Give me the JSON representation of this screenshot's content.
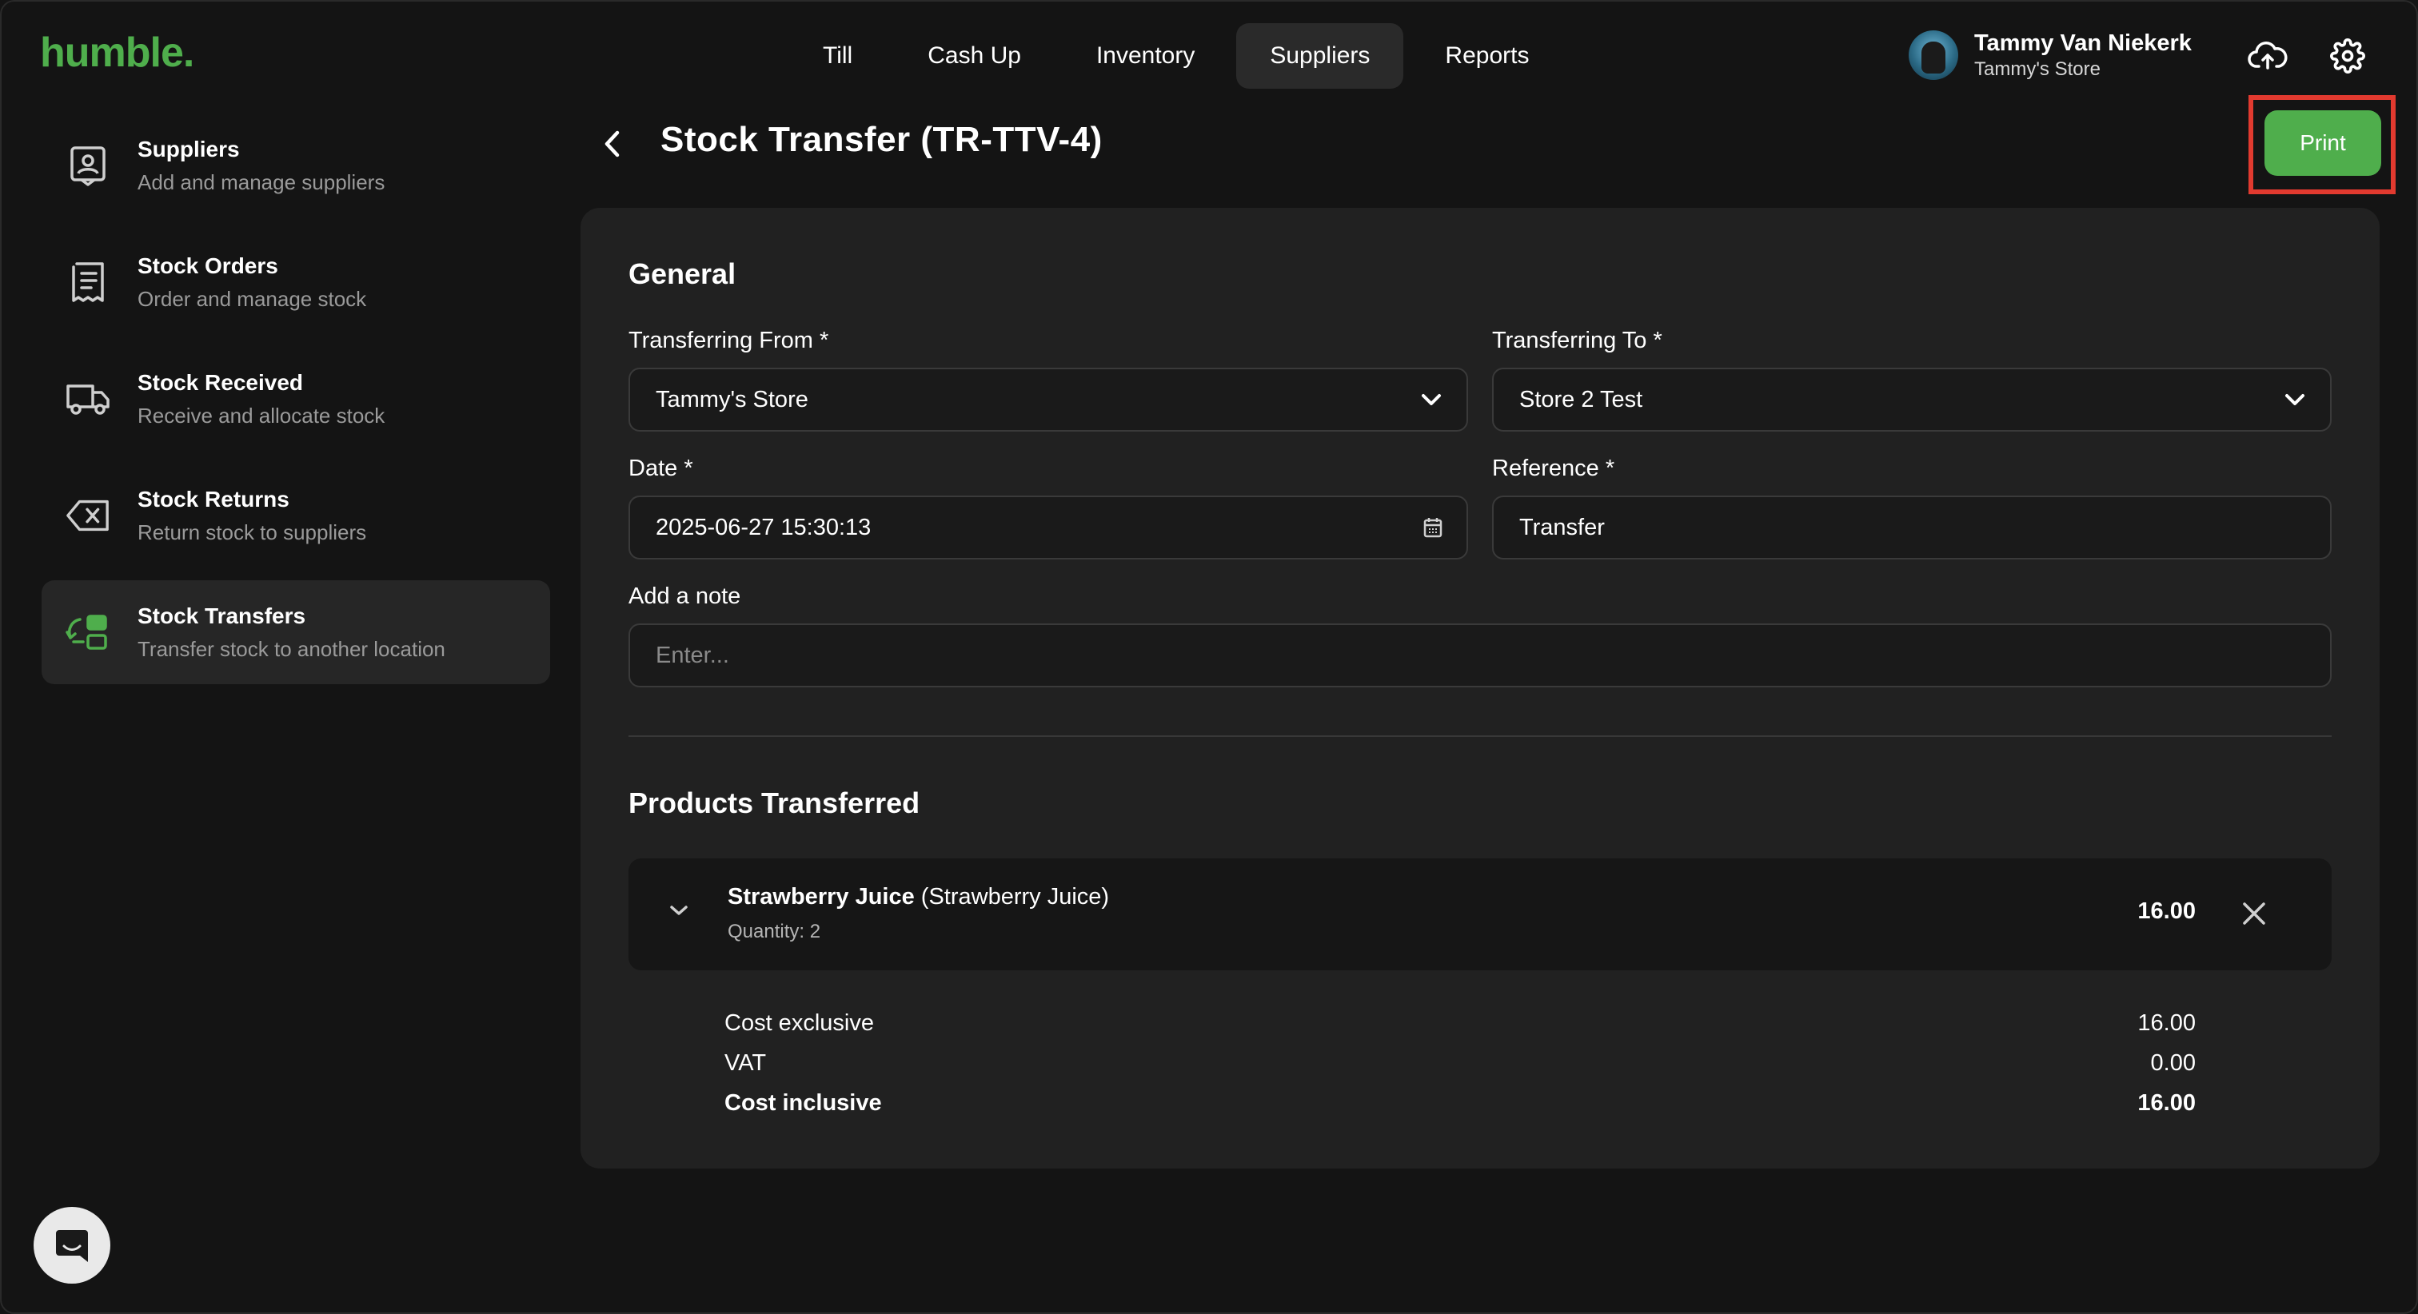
{
  "app": {
    "logo": "humble."
  },
  "topnav": {
    "tabs": [
      {
        "label": "Till"
      },
      {
        "label": "Cash Up"
      },
      {
        "label": "Inventory"
      },
      {
        "label": "Suppliers",
        "active": true
      },
      {
        "label": "Reports"
      }
    ]
  },
  "user": {
    "name": "Tammy Van Niekerk",
    "store": "Tammy's Store"
  },
  "sidebar": {
    "items": [
      {
        "title": "Suppliers",
        "subtitle": "Add and manage suppliers",
        "icon": "supplier-id-icon"
      },
      {
        "title": "Stock Orders",
        "subtitle": "Order and manage stock",
        "icon": "receipt-icon"
      },
      {
        "title": "Stock Received",
        "subtitle": "Receive and allocate stock",
        "icon": "truck-icon"
      },
      {
        "title": "Stock Returns",
        "subtitle": "Return stock to suppliers",
        "icon": "backspace-icon"
      },
      {
        "title": "Stock Transfers",
        "subtitle": "Transfer stock to another location",
        "icon": "transfer-icon",
        "active": true
      }
    ]
  },
  "header": {
    "title": "Stock Transfer (TR-TTV-4)",
    "print_label": "Print"
  },
  "general": {
    "title": "General",
    "from_label": "Transferring From *",
    "from_value": "Tammy's Store",
    "to_label": "Transferring To *",
    "to_value": "Store 2 Test",
    "date_label": "Date *",
    "date_value": "2025-06-27 15:30:13",
    "reference_label": "Reference *",
    "reference_value": "Transfer",
    "note_label": "Add a note",
    "note_placeholder": "Enter..."
  },
  "products": {
    "title": "Products Transferred",
    "items": [
      {
        "name": "Strawberry Juice",
        "variant": "(Strawberry Juice)",
        "quantity": "Quantity: 2",
        "total": "16.00"
      }
    ],
    "totals": {
      "cost_exclusive_label": "Cost exclusive",
      "cost_exclusive": "16.00",
      "vat_label": "VAT",
      "vat": "0.00",
      "cost_inclusive_label": "Cost inclusive",
      "cost_inclusive": "16.00"
    }
  },
  "colors": {
    "accent": "#4fae4c",
    "highlight": "#e23a2f",
    "background": "#141414",
    "card": "#212121"
  }
}
